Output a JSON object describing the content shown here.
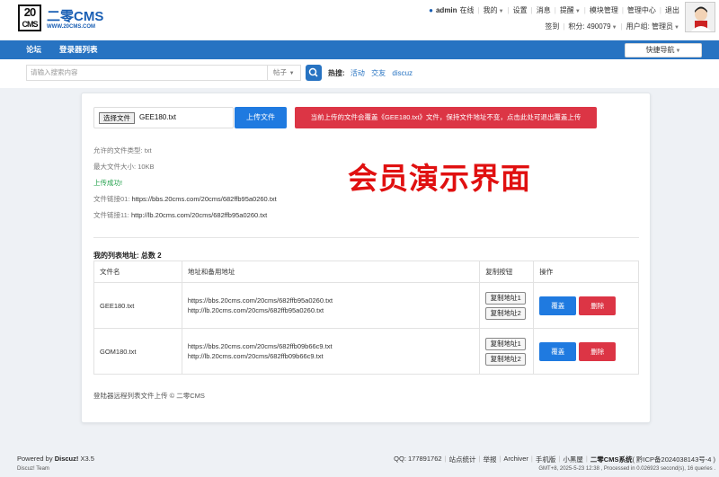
{
  "brand": {
    "mark_top": "20",
    "mark_bottom": "CMS",
    "name": "二零CMS",
    "url": "WWW.20CMS.COM"
  },
  "header": {
    "username": "admin",
    "online": "在线",
    "mine": "我的",
    "settings": "设置",
    "messages": "消息",
    "reminders": "提醒",
    "module_manage": "模块管理",
    "manage_center": "管理中心",
    "logout": "退出",
    "signin": "签到",
    "points": "积分: 490079",
    "user_group": "用户组: 管理员"
  },
  "nav": {
    "tabs": [
      {
        "label": "论坛"
      },
      {
        "label": "登录器列表"
      }
    ],
    "quick_nav": "快捷导航"
  },
  "search": {
    "placeholder": "请输入搜索内容",
    "type": "帖子",
    "hot_label": "热搜:",
    "hot_words": [
      "活动",
      "交友",
      "discuz"
    ]
  },
  "upload": {
    "choose_label": "选择文件",
    "file_name": "GEE180.txt",
    "upload_button": "上传文件",
    "overwrite_notice": "当前上传的文件会覆盖《GEE180.txt》文件，保持文件地址不变，点击此处可退出覆盖上传",
    "allowed_types_label": "允许的文件类型:",
    "allowed_types": "txt",
    "max_size_label": "最大文件大小:",
    "max_size": "10KB",
    "success": "上传成功!",
    "link1_label": "文件链接01:",
    "link1": "https://bbs.20cms.com/20cms/682ffb95a0260.txt",
    "link2_label": "文件链接11:",
    "link2": "http://lb.20cms.com/20cms/682ffb95a0260.txt"
  },
  "watermark": "会员演示界面",
  "list": {
    "title": "我的列表地址: 总数 2",
    "columns": [
      "文件名",
      "地址和备用地址",
      "复制按钮",
      "操作"
    ],
    "rows": [
      {
        "filename": "GEE180.txt",
        "addr1": "https://bbs.20cms.com/20cms/682ffb95a0260.txt",
        "addr2": "http://lb.20cms.com/20cms/682ffb95a0260.txt",
        "copy1": "复制地址1",
        "copy2": "复制地址2",
        "overwrite": "覆盖",
        "delete": "删除"
      },
      {
        "filename": "GOM180.txt",
        "addr1": "https://bbs.20cms.com/20cms/682ffb09b66c9.txt",
        "addr2": "http://lb.20cms.com/20cms/682ffb09b66c9.txt",
        "copy1": "复制地址1",
        "copy2": "复制地址2",
        "overwrite": "覆盖",
        "delete": "删除"
      }
    ]
  },
  "card_footer": "登陆器远程列表文件上传 © 二零CMS",
  "footer": {
    "powered_by": "Powered by",
    "discuz": "Discuz!",
    "version": "X3.5",
    "team": "Discuz! Team",
    "qq": "QQ: 177891762",
    "links": [
      "站点统计",
      "举报",
      "Archiver",
      "手机版",
      "小黑屋"
    ],
    "site_name": "二零CMS系统",
    "icp": "( 黔ICP备2024038143号-4 )",
    "gmt": "GMT+8, 2025-5-23 12:38 , Processed in 0.026923 second(s), 16 queries ."
  }
}
